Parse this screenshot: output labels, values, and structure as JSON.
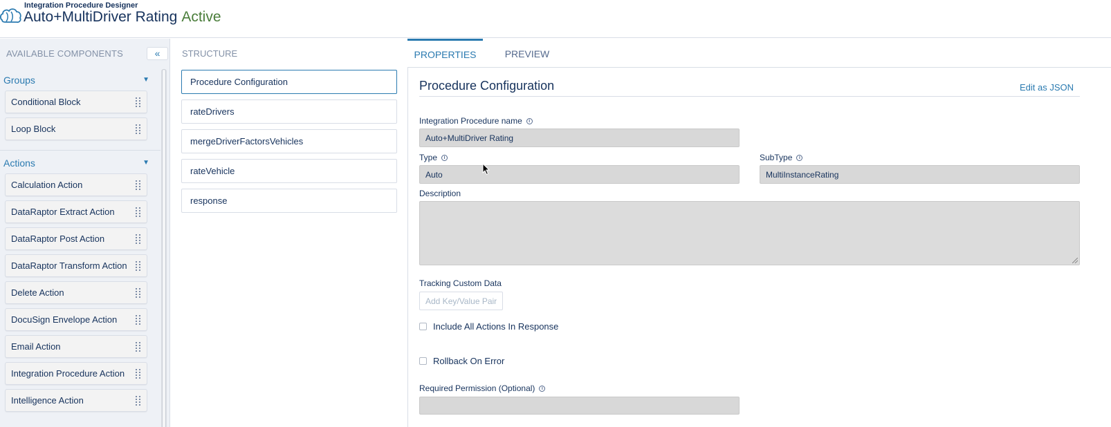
{
  "header": {
    "subtitle": "Integration Procedure Designer",
    "title": "Auto+MultiDriver Rating",
    "status": "Active"
  },
  "left_panel": {
    "heading": "AVAILABLE COMPONENTS",
    "collapse_label": "«",
    "groups": {
      "title": "Groups",
      "items": [
        "Conditional Block",
        "Loop Block"
      ]
    },
    "actions": {
      "title": "Actions",
      "items": [
        "Calculation Action",
        "DataRaptor Extract Action",
        "DataRaptor Post Action",
        "DataRaptor Transform Action",
        "Delete Action",
        "DocuSign Envelope Action",
        "Email Action",
        "Integration Procedure Action",
        "Intelligence Action"
      ]
    }
  },
  "structure": {
    "heading": "STRUCTURE",
    "steps": [
      "Procedure Configuration",
      "rateDrivers",
      "mergeDriverFactorsVehicles",
      "rateVehicle",
      "response"
    ]
  },
  "tabs": [
    "PROPERTIES",
    "PREVIEW"
  ],
  "properties": {
    "title": "Procedure Configuration",
    "edit_json": "Edit as JSON",
    "name_label": "Integration Procedure name",
    "name_value": "Auto+MultiDriver Rating",
    "type_label": "Type",
    "type_value": "Auto",
    "subtype_label": "SubType",
    "subtype_value": "MultiInstanceRating",
    "description_label": "Description",
    "tracking_label": "Tracking Custom Data",
    "kv_placeholder": "Add Key/Value Pair",
    "include_all_label": "Include All Actions In Response",
    "rollback_label": "Rollback On Error",
    "permission_label": "Required Permission (Optional)",
    "info_glyph": "i"
  }
}
